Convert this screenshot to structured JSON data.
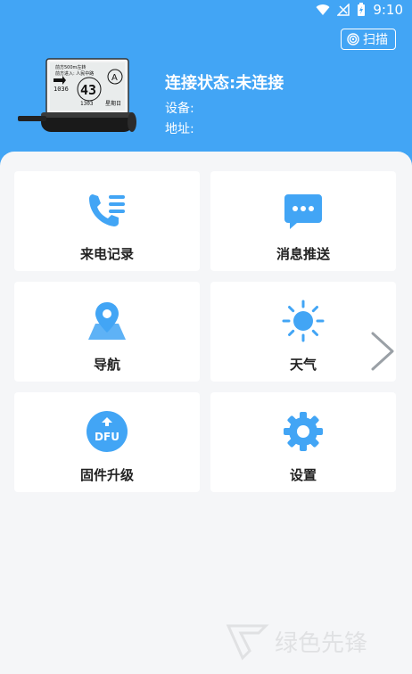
{
  "status_bar": {
    "time": "9:10"
  },
  "header": {
    "scan_label": "扫描",
    "connection_status": "连接状态:未连接",
    "device_label": "设备:",
    "address_label": "地址:"
  },
  "device_screen": {
    "line1": "前方500m左转",
    "line2": "前方进入: 人民中路",
    "big_number": "43",
    "small_left": "1036",
    "small_mid": "1303",
    "small_right": "星期日",
    "letter": "A"
  },
  "menu": [
    {
      "label": "来电记录",
      "icon": "phone-list-icon"
    },
    {
      "label": "消息推送",
      "icon": "message-bubble-icon"
    },
    {
      "label": "导航",
      "icon": "map-pin-icon"
    },
    {
      "label": "天气",
      "icon": "sun-icon"
    },
    {
      "label": "固件升级",
      "icon": "dfu-icon"
    },
    {
      "label": "设置",
      "icon": "gear-icon"
    }
  ],
  "dfu_text": "DFU",
  "colors": {
    "primary": "#42a5f5",
    "card": "#ffffff",
    "background": "#f5f6f8"
  },
  "watermark": "绿色先锋"
}
